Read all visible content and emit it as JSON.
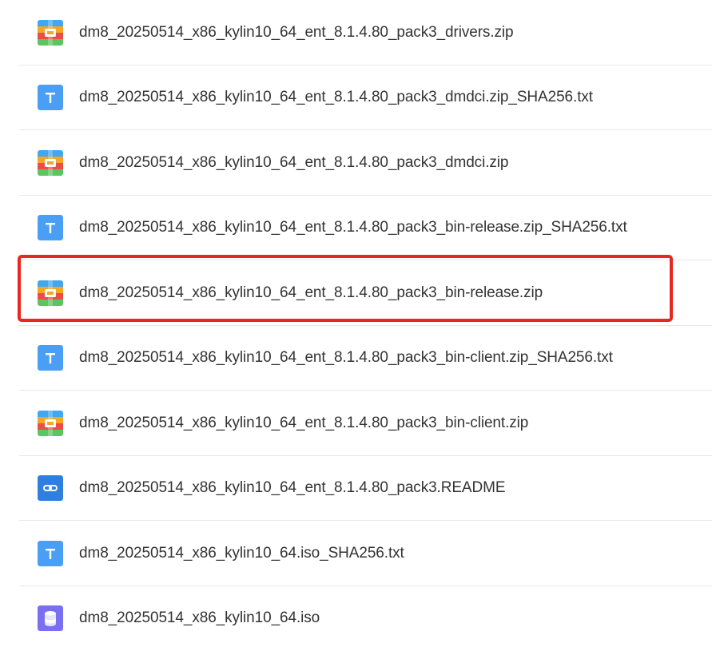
{
  "files": [
    {
      "name": "dm8_20250514_x86_kylin10_64_ent_8.1.4.80_pack3_drivers.zip",
      "icon": "zip-archive-icon"
    },
    {
      "name": "dm8_20250514_x86_kylin10_64_ent_8.1.4.80_pack3_dmdci.zip_SHA256.txt",
      "icon": "text-file-icon"
    },
    {
      "name": "dm8_20250514_x86_kylin10_64_ent_8.1.4.80_pack3_dmdci.zip",
      "icon": "zip-archive-icon"
    },
    {
      "name": "dm8_20250514_x86_kylin10_64_ent_8.1.4.80_pack3_bin-release.zip_SHA256.txt",
      "icon": "text-file-icon"
    },
    {
      "name": "dm8_20250514_x86_kylin10_64_ent_8.1.4.80_pack3_bin-release.zip",
      "icon": "zip-archive-icon"
    },
    {
      "name": "dm8_20250514_x86_kylin10_64_ent_8.1.4.80_pack3_bin-client.zip_SHA256.txt",
      "icon": "text-file-icon"
    },
    {
      "name": "dm8_20250514_x86_kylin10_64_ent_8.1.4.80_pack3_bin-client.zip",
      "icon": "zip-archive-icon"
    },
    {
      "name": "dm8_20250514_x86_kylin10_64_ent_8.1.4.80_pack3.README",
      "icon": "link-file-icon"
    },
    {
      "name": "dm8_20250514_x86_kylin10_64.iso_SHA256.txt",
      "icon": "text-file-icon"
    },
    {
      "name": "dm8_20250514_x86_kylin10_64.iso",
      "icon": "disk-image-icon"
    }
  ],
  "colors": {
    "highlight": "#e8281e",
    "text_icon": "#4a9ff5",
    "link_icon": "#2f7fe0",
    "iso_icon": "#7a6ff0",
    "divider": "#e8e8ea"
  }
}
